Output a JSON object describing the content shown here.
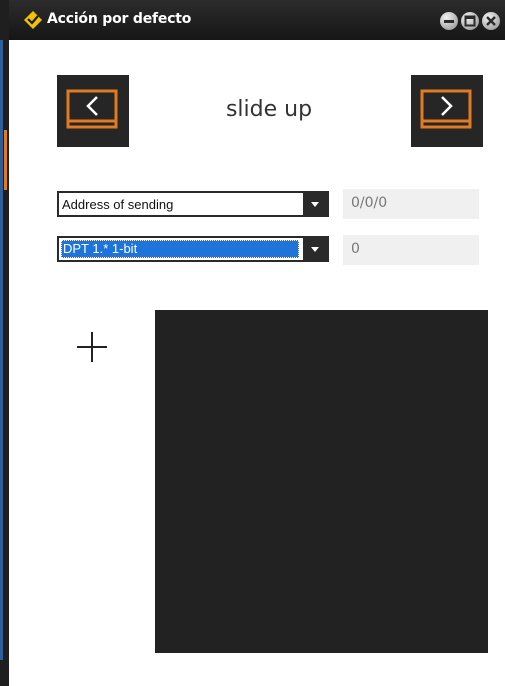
{
  "window": {
    "title": "Acción por defecto",
    "controls": [
      "minimize-icon",
      "maximize-icon",
      "close-icon"
    ]
  },
  "navigation": {
    "prev_icon": "chevron-left-icon",
    "next_icon": "chevron-right-icon",
    "accent_color": "#e07b22"
  },
  "mode": {
    "title": "slide up"
  },
  "address_row": {
    "select_value": "Address of sending",
    "value": "0/0/0"
  },
  "dpt_row": {
    "select_value": "DPT 1.* 1-bit",
    "value": "0",
    "highlight_color": "#1e74d8"
  },
  "actions": {
    "add_icon": "plus-icon"
  },
  "colors": {
    "titlebar": "#1c1c1c",
    "panel": "#222222",
    "value_bg": "#f0f0f0"
  }
}
